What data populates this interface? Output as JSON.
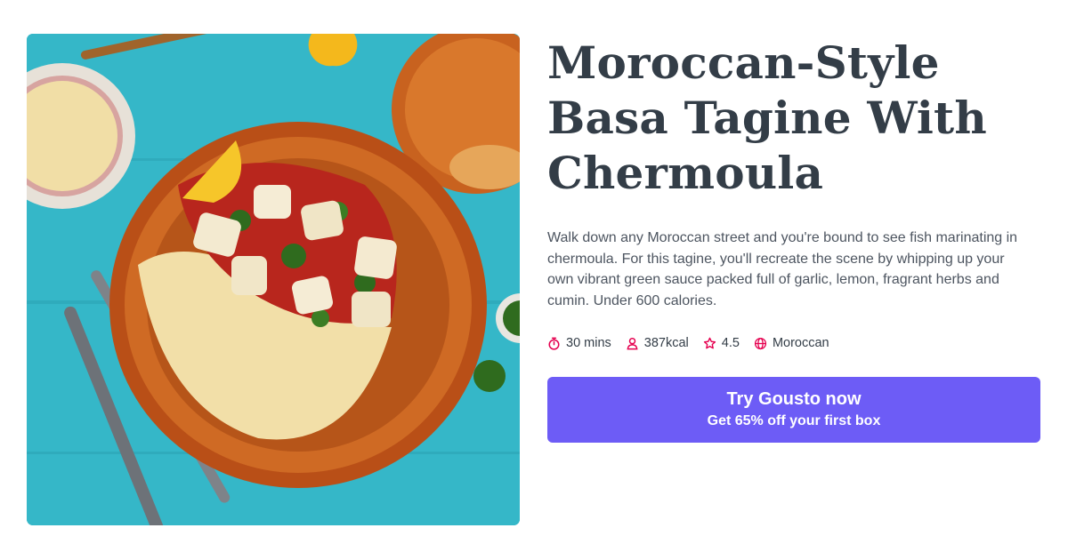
{
  "recipe": {
    "title": "Moroccan-Style Basa Tagine With Chermoula",
    "description": "Walk down any Moroccan street and you're bound to see fish marinating in chermoula. For this tagine, you'll recreate the scene by whipping up your own vibrant green sauce packed full of garlic, lemon, fragrant herbs and cumin. Under 600 calories.",
    "meta": {
      "time": "30 mins",
      "calories": "387kcal",
      "rating": "4.5",
      "cuisine": "Moroccan"
    }
  },
  "cta": {
    "title": "Try Gousto now",
    "subtitle": "Get 65% off your first box"
  },
  "icons": {
    "time": "stopwatch-icon",
    "calories": "person-icon",
    "rating": "star-icon",
    "cuisine": "globe-icon"
  },
  "colors": {
    "accent": "#6d5cf6",
    "icon": "#e5004f",
    "text": "#333d47"
  }
}
